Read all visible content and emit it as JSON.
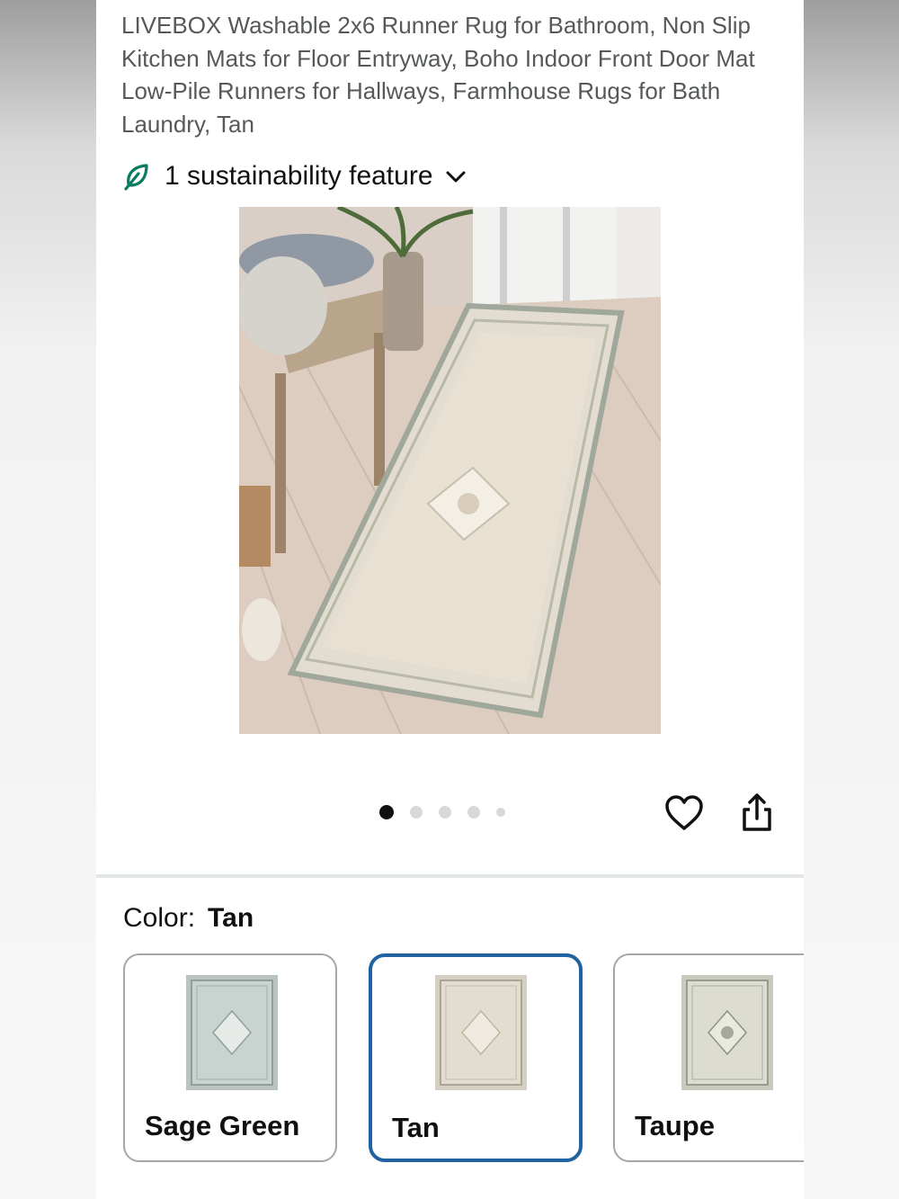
{
  "product": {
    "title": "LIVEBOX Washable 2x6 Runner Rug for Bathroom, Non Slip Kitchen Mats for Floor Entryway, Boho Indoor Front Door Mat Low-Pile Runners for Hallways, Farmhouse Rugs for Bath Laundry, Tan",
    "sustainability_label": "1 sustainability feature"
  },
  "gallery": {
    "image_count": 5,
    "active_index": 0
  },
  "color": {
    "label": "Color:",
    "selected": "Tan",
    "options": [
      {
        "name": "Sage Green"
      },
      {
        "name": "Tan"
      },
      {
        "name": "Taupe"
      }
    ]
  },
  "colors": {
    "accent_selected_border": "#2162a1",
    "sustainability_leaf": "#067d62",
    "title_text": "#565959"
  },
  "icons": {
    "sustainability": "leaf-icon",
    "expand": "chevron-down-icon",
    "wishlist": "heart-icon",
    "share": "share-icon"
  }
}
